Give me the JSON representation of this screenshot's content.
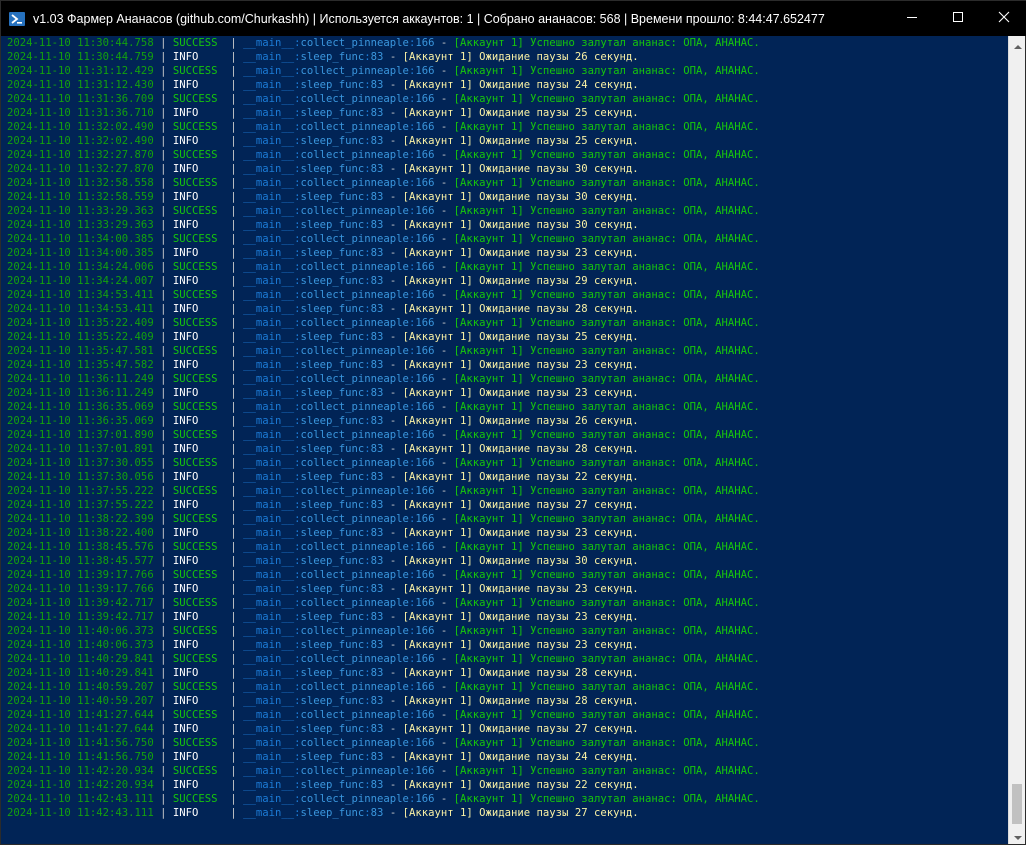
{
  "window": {
    "title": "v1.03 Фармер Ананасов (github.com/Churkashh) | Используется аккаунтов: 1 | Собрано ананасов: 568 | Времени прошло: 8:44:47.652477",
    "icon": "powershell-icon",
    "controls": {
      "minimize": "minimize-icon",
      "maximize": "maximize-icon",
      "close": "close-icon"
    }
  },
  "colors": {
    "background": "#012456",
    "timestamp": "#13a10e",
    "success": "#16c60c",
    "info_level": "#ffffff",
    "module": "#3a96dd",
    "info_message": "#f9f1a5"
  },
  "log_format": {
    "separator": "|",
    "module": "__main__",
    "dash": "-"
  },
  "log": [
    {
      "ts": "2024-11-10 11:30:44.758",
      "level": "SUCCESS",
      "func": "collect_pinneaple",
      "line": "166",
      "msg": "[Аккаунт 1] Успешно залутал ананас: ОПА, АНАНАС."
    },
    {
      "ts": "2024-11-10 11:30:44.759",
      "level": "INFO",
      "func": "sleep_func",
      "line": "83",
      "msg": "[Аккаунт 1] Ожидание паузы 26 секунд."
    },
    {
      "ts": "2024-11-10 11:31:12.429",
      "level": "SUCCESS",
      "func": "collect_pinneaple",
      "line": "166",
      "msg": "[Аккаунт 1] Успешно залутал ананас: ОПА, АНАНАС."
    },
    {
      "ts": "2024-11-10 11:31:12.430",
      "level": "INFO",
      "func": "sleep_func",
      "line": "83",
      "msg": "[Аккаунт 1] Ожидание паузы 24 секунд."
    },
    {
      "ts": "2024-11-10 11:31:36.709",
      "level": "SUCCESS",
      "func": "collect_pinneaple",
      "line": "166",
      "msg": "[Аккаунт 1] Успешно залутал ананас: ОПА, АНАНАС."
    },
    {
      "ts": "2024-11-10 11:31:36.710",
      "level": "INFO",
      "func": "sleep_func",
      "line": "83",
      "msg": "[Аккаунт 1] Ожидание паузы 25 секунд."
    },
    {
      "ts": "2024-11-10 11:32:02.490",
      "level": "SUCCESS",
      "func": "collect_pinneaple",
      "line": "166",
      "msg": "[Аккаунт 1] Успешно залутал ананас: ОПА, АНАНАС."
    },
    {
      "ts": "2024-11-10 11:32:02.490",
      "level": "INFO",
      "func": "sleep_func",
      "line": "83",
      "msg": "[Аккаунт 1] Ожидание паузы 25 секунд."
    },
    {
      "ts": "2024-11-10 11:32:27.870",
      "level": "SUCCESS",
      "func": "collect_pinneaple",
      "line": "166",
      "msg": "[Аккаунт 1] Успешно залутал ананас: ОПА, АНАНАС."
    },
    {
      "ts": "2024-11-10 11:32:27.870",
      "level": "INFO",
      "func": "sleep_func",
      "line": "83",
      "msg": "[Аккаунт 1] Ожидание паузы 30 секунд."
    },
    {
      "ts": "2024-11-10 11:32:58.558",
      "level": "SUCCESS",
      "func": "collect_pinneaple",
      "line": "166",
      "msg": "[Аккаунт 1] Успешно залутал ананас: ОПА, АНАНАС."
    },
    {
      "ts": "2024-11-10 11:32:58.559",
      "level": "INFO",
      "func": "sleep_func",
      "line": "83",
      "msg": "[Аккаунт 1] Ожидание паузы 30 секунд."
    },
    {
      "ts": "2024-11-10 11:33:29.363",
      "level": "SUCCESS",
      "func": "collect_pinneaple",
      "line": "166",
      "msg": "[Аккаунт 1] Успешно залутал ананас: ОПА, АНАНАС."
    },
    {
      "ts": "2024-11-10 11:33:29.363",
      "level": "INFO",
      "func": "sleep_func",
      "line": "83",
      "msg": "[Аккаунт 1] Ожидание паузы 30 секунд."
    },
    {
      "ts": "2024-11-10 11:34:00.385",
      "level": "SUCCESS",
      "func": "collect_pinneaple",
      "line": "166",
      "msg": "[Аккаунт 1] Успешно залутал ананас: ОПА, АНАНАС."
    },
    {
      "ts": "2024-11-10 11:34:00.385",
      "level": "INFO",
      "func": "sleep_func",
      "line": "83",
      "msg": "[Аккаунт 1] Ожидание паузы 23 секунд."
    },
    {
      "ts": "2024-11-10 11:34:24.006",
      "level": "SUCCESS",
      "func": "collect_pinneaple",
      "line": "166",
      "msg": "[Аккаунт 1] Успешно залутал ананас: ОПА, АНАНАС."
    },
    {
      "ts": "2024-11-10 11:34:24.007",
      "level": "INFO",
      "func": "sleep_func",
      "line": "83",
      "msg": "[Аккаунт 1] Ожидание паузы 29 секунд."
    },
    {
      "ts": "2024-11-10 11:34:53.411",
      "level": "SUCCESS",
      "func": "collect_pinneaple",
      "line": "166",
      "msg": "[Аккаунт 1] Успешно залутал ананас: ОПА, АНАНАС."
    },
    {
      "ts": "2024-11-10 11:34:53.411",
      "level": "INFO",
      "func": "sleep_func",
      "line": "83",
      "msg": "[Аккаунт 1] Ожидание паузы 28 секунд."
    },
    {
      "ts": "2024-11-10 11:35:22.409",
      "level": "SUCCESS",
      "func": "collect_pinneaple",
      "line": "166",
      "msg": "[Аккаунт 1] Успешно залутал ананас: ОПА, АНАНАС."
    },
    {
      "ts": "2024-11-10 11:35:22.409",
      "level": "INFO",
      "func": "sleep_func",
      "line": "83",
      "msg": "[Аккаунт 1] Ожидание паузы 25 секунд."
    },
    {
      "ts": "2024-11-10 11:35:47.581",
      "level": "SUCCESS",
      "func": "collect_pinneaple",
      "line": "166",
      "msg": "[Аккаунт 1] Успешно залутал ананас: ОПА, АНАНАС."
    },
    {
      "ts": "2024-11-10 11:35:47.582",
      "level": "INFO",
      "func": "sleep_func",
      "line": "83",
      "msg": "[Аккаунт 1] Ожидание паузы 23 секунд."
    },
    {
      "ts": "2024-11-10 11:36:11.249",
      "level": "SUCCESS",
      "func": "collect_pinneaple",
      "line": "166",
      "msg": "[Аккаунт 1] Успешно залутал ананас: ОПА, АНАНАС."
    },
    {
      "ts": "2024-11-10 11:36:11.249",
      "level": "INFO",
      "func": "sleep_func",
      "line": "83",
      "msg": "[Аккаунт 1] Ожидание паузы 23 секунд."
    },
    {
      "ts": "2024-11-10 11:36:35.069",
      "level": "SUCCESS",
      "func": "collect_pinneaple",
      "line": "166",
      "msg": "[Аккаунт 1] Успешно залутал ананас: ОПА, АНАНАС."
    },
    {
      "ts": "2024-11-10 11:36:35.069",
      "level": "INFO",
      "func": "sleep_func",
      "line": "83",
      "msg": "[Аккаунт 1] Ожидание паузы 26 секунд."
    },
    {
      "ts": "2024-11-10 11:37:01.890",
      "level": "SUCCESS",
      "func": "collect_pinneaple",
      "line": "166",
      "msg": "[Аккаунт 1] Успешно залутал ананас: ОПА, АНАНАС."
    },
    {
      "ts": "2024-11-10 11:37:01.891",
      "level": "INFO",
      "func": "sleep_func",
      "line": "83",
      "msg": "[Аккаунт 1] Ожидание паузы 28 секунд."
    },
    {
      "ts": "2024-11-10 11:37:30.055",
      "level": "SUCCESS",
      "func": "collect_pinneaple",
      "line": "166",
      "msg": "[Аккаунт 1] Успешно залутал ананас: ОПА, АНАНАС."
    },
    {
      "ts": "2024-11-10 11:37:30.056",
      "level": "INFO",
      "func": "sleep_func",
      "line": "83",
      "msg": "[Аккаунт 1] Ожидание паузы 22 секунд."
    },
    {
      "ts": "2024-11-10 11:37:55.222",
      "level": "SUCCESS",
      "func": "collect_pinneaple",
      "line": "166",
      "msg": "[Аккаунт 1] Успешно залутал ананас: ОПА, АНАНАС."
    },
    {
      "ts": "2024-11-10 11:37:55.222",
      "level": "INFO",
      "func": "sleep_func",
      "line": "83",
      "msg": "[Аккаунт 1] Ожидание паузы 27 секунд."
    },
    {
      "ts": "2024-11-10 11:38:22.399",
      "level": "SUCCESS",
      "func": "collect_pinneaple",
      "line": "166",
      "msg": "[Аккаунт 1] Успешно залутал ананас: ОПА, АНАНАС."
    },
    {
      "ts": "2024-11-10 11:38:22.400",
      "level": "INFO",
      "func": "sleep_func",
      "line": "83",
      "msg": "[Аккаунт 1] Ожидание паузы 23 секунд."
    },
    {
      "ts": "2024-11-10 11:38:45.576",
      "level": "SUCCESS",
      "func": "collect_pinneaple",
      "line": "166",
      "msg": "[Аккаунт 1] Успешно залутал ананас: ОПА, АНАНАС."
    },
    {
      "ts": "2024-11-10 11:38:45.577",
      "level": "INFO",
      "func": "sleep_func",
      "line": "83",
      "msg": "[Аккаунт 1] Ожидание паузы 30 секунд."
    },
    {
      "ts": "2024-11-10 11:39:17.766",
      "level": "SUCCESS",
      "func": "collect_pinneaple",
      "line": "166",
      "msg": "[Аккаунт 1] Успешно залутал ананас: ОПА, АНАНАС."
    },
    {
      "ts": "2024-11-10 11:39:17.766",
      "level": "INFO",
      "func": "sleep_func",
      "line": "83",
      "msg": "[Аккаунт 1] Ожидание паузы 23 секунд."
    },
    {
      "ts": "2024-11-10 11:39:42.717",
      "level": "SUCCESS",
      "func": "collect_pinneaple",
      "line": "166",
      "msg": "[Аккаунт 1] Успешно залутал ананас: ОПА, АНАНАС."
    },
    {
      "ts": "2024-11-10 11:39:42.717",
      "level": "INFO",
      "func": "sleep_func",
      "line": "83",
      "msg": "[Аккаунт 1] Ожидание паузы 23 секунд."
    },
    {
      "ts": "2024-11-10 11:40:06.373",
      "level": "SUCCESS",
      "func": "collect_pinneaple",
      "line": "166",
      "msg": "[Аккаунт 1] Успешно залутал ананас: ОПА, АНАНАС."
    },
    {
      "ts": "2024-11-10 11:40:06.373",
      "level": "INFO",
      "func": "sleep_func",
      "line": "83",
      "msg": "[Аккаунт 1] Ожидание паузы 23 секунд."
    },
    {
      "ts": "2024-11-10 11:40:29.841",
      "level": "SUCCESS",
      "func": "collect_pinneaple",
      "line": "166",
      "msg": "[Аккаунт 1] Успешно залутал ананас: ОПА, АНАНАС."
    },
    {
      "ts": "2024-11-10 11:40:29.841",
      "level": "INFO",
      "func": "sleep_func",
      "line": "83",
      "msg": "[Аккаунт 1] Ожидание паузы 28 секунд."
    },
    {
      "ts": "2024-11-10 11:40:59.207",
      "level": "SUCCESS",
      "func": "collect_pinneaple",
      "line": "166",
      "msg": "[Аккаунт 1] Успешно залутал ананас: ОПА, АНАНАС."
    },
    {
      "ts": "2024-11-10 11:40:59.207",
      "level": "INFO",
      "func": "sleep_func",
      "line": "83",
      "msg": "[Аккаунт 1] Ожидание паузы 28 секунд."
    },
    {
      "ts": "2024-11-10 11:41:27.644",
      "level": "SUCCESS",
      "func": "collect_pinneaple",
      "line": "166",
      "msg": "[Аккаунт 1] Успешно залутал ананас: ОПА, АНАНАС."
    },
    {
      "ts": "2024-11-10 11:41:27.644",
      "level": "INFO",
      "func": "sleep_func",
      "line": "83",
      "msg": "[Аккаунт 1] Ожидание паузы 27 секунд."
    },
    {
      "ts": "2024-11-10 11:41:56.750",
      "level": "SUCCESS",
      "func": "collect_pinneaple",
      "line": "166",
      "msg": "[Аккаунт 1] Успешно залутал ананас: ОПА, АНАНАС."
    },
    {
      "ts": "2024-11-10 11:41:56.750",
      "level": "INFO",
      "func": "sleep_func",
      "line": "83",
      "msg": "[Аккаунт 1] Ожидание паузы 24 секунд."
    },
    {
      "ts": "2024-11-10 11:42:20.934",
      "level": "SUCCESS",
      "func": "collect_pinneaple",
      "line": "166",
      "msg": "[Аккаунт 1] Успешно залутал ананас: ОПА, АНАНАС."
    },
    {
      "ts": "2024-11-10 11:42:20.934",
      "level": "INFO",
      "func": "sleep_func",
      "line": "83",
      "msg": "[Аккаунт 1] Ожидание паузы 22 секунд."
    },
    {
      "ts": "2024-11-10 11:42:43.111",
      "level": "SUCCESS",
      "func": "collect_pinneaple",
      "line": "166",
      "msg": "[Аккаунт 1] Успешно залутал ананас: ОПА, АНАНАС."
    },
    {
      "ts": "2024-11-10 11:42:43.111",
      "level": "INFO",
      "func": "sleep_func",
      "line": "83",
      "msg": "[Аккаунт 1] Ожидание паузы 27 секунд."
    }
  ]
}
